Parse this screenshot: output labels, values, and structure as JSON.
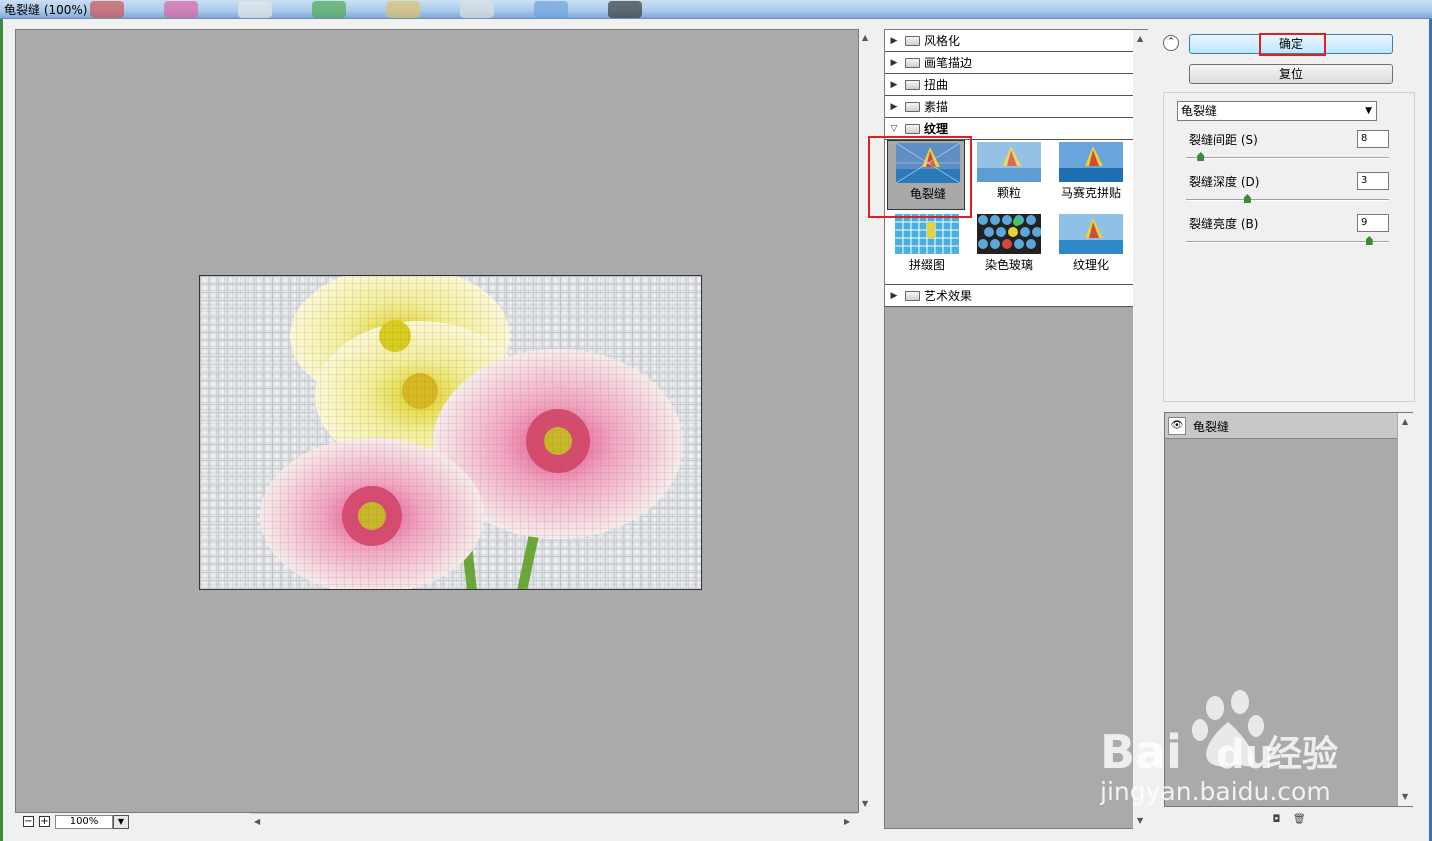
{
  "window": {
    "title": "龟裂缝 (100%)"
  },
  "taskbar_colors": [
    "#d24a4a",
    "#e05a9a",
    "#e8e8e8",
    "#48a848",
    "#e0c060",
    "#e0e0e0",
    "#6aa0d8",
    "#333333"
  ],
  "preview": {
    "zoom": "100%",
    "zoom_out": "−",
    "zoom_in": "+",
    "dropdown": "▼",
    "scroll_up": "▲",
    "scroll_down": "▼",
    "scroll_left": "◀",
    "scroll_right": "▶"
  },
  "gallery": {
    "categories_top": [
      {
        "label": "风格化",
        "toggle": "▶"
      },
      {
        "label": "画笔描边",
        "toggle": "▶"
      },
      {
        "label": "扭曲",
        "toggle": "▶"
      },
      {
        "label": "素描",
        "toggle": "▶"
      }
    ],
    "open_category": {
      "label": "纹理",
      "toggle": "▽"
    },
    "thumbs": [
      {
        "name": "龟裂缝"
      },
      {
        "name": "颗粒"
      },
      {
        "name": "马赛克拼贴"
      },
      {
        "name": "拼缀图"
      },
      {
        "name": "染色玻璃"
      },
      {
        "name": "纹理化"
      }
    ],
    "categories_bottom": [
      {
        "label": "艺术效果",
        "toggle": "▶"
      }
    ]
  },
  "panel": {
    "collapse": "⌃",
    "ok_label": "确定",
    "reset_label": "复位",
    "filter_select": "龟裂缝",
    "caret": "▼",
    "params": [
      {
        "label": "裂缝间距 (S)",
        "value": "8",
        "fraction": 0.07
      },
      {
        "label": "裂缝深度 (D)",
        "value": "3",
        "fraction": 0.3
      },
      {
        "label": "裂缝亮度 (B)",
        "value": "9",
        "fraction": 0.9
      }
    ],
    "layer": {
      "name": "龟裂缝",
      "eye": "👁"
    },
    "new_layer": "◘",
    "delete_layer": "🗑"
  },
  "watermark": {
    "brand": "Bai",
    "brand2": "du",
    "brand_cn": "经验",
    "url": "jingyan.baidu.com"
  }
}
